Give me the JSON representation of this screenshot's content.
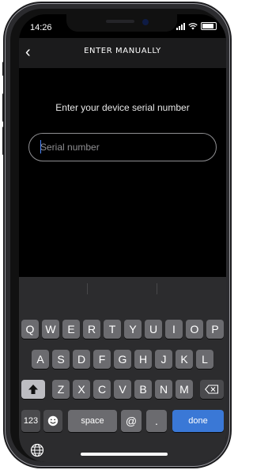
{
  "status_bar": {
    "time": "14:26"
  },
  "nav": {
    "back_icon": "‹",
    "title": "ENTER MANUALLY"
  },
  "prompt": {
    "text": "Enter your device serial number"
  },
  "serial_input": {
    "placeholder": "Serial number",
    "value": ""
  },
  "keyboard": {
    "row1": [
      "Q",
      "W",
      "E",
      "R",
      "T",
      "Y",
      "U",
      "I",
      "O",
      "P"
    ],
    "row2": [
      "A",
      "S",
      "D",
      "F",
      "G",
      "H",
      "J",
      "K",
      "L"
    ],
    "row3": [
      "Z",
      "X",
      "C",
      "V",
      "B",
      "N",
      "M"
    ],
    "numbers_label": "123",
    "space_label": "space",
    "at_label": "@",
    "dot_label": ".",
    "done_label": "done",
    "shift_icon": "shift-icon",
    "delete_icon": "backspace-icon",
    "emoji_icon": "emoji-icon",
    "globe_icon": "globe-icon",
    "colors": {
      "done_key": "#3a78d6"
    }
  }
}
